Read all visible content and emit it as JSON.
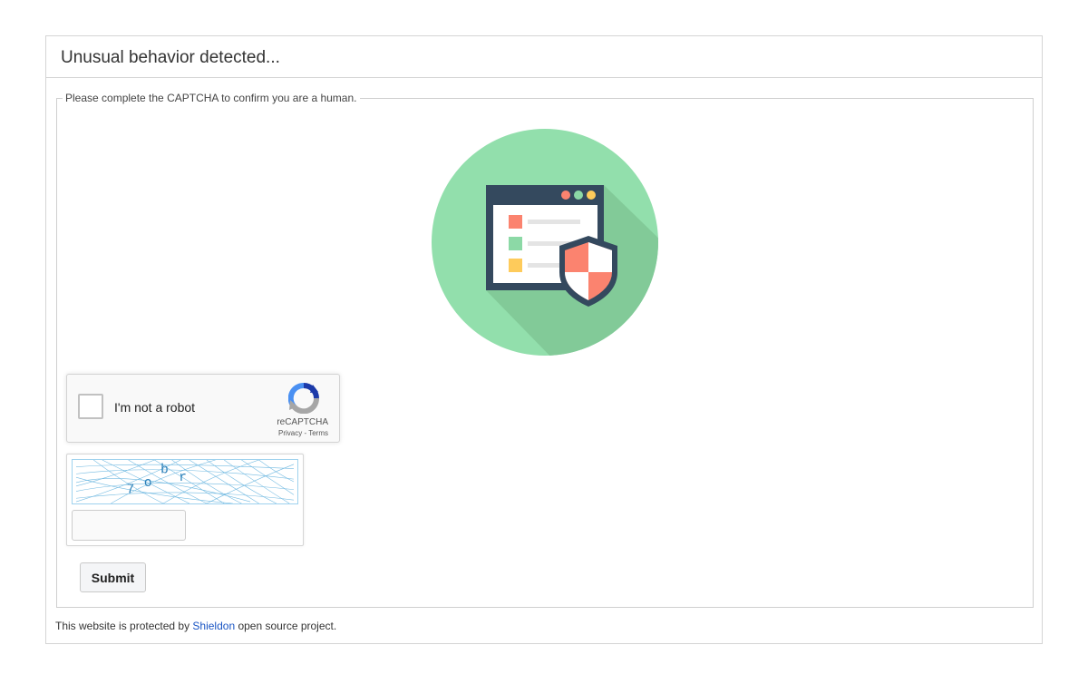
{
  "header": {
    "title": "Unusual behavior detected..."
  },
  "form": {
    "legend": "Please complete the CAPTCHA to confirm you are a human."
  },
  "illustration": {
    "icon": "browser-shield-illustration",
    "colors": {
      "circle": "#92dfac",
      "shadow": "#82ca98",
      "window": "#34495e",
      "red": "#fb836f",
      "green": "#8cd9a6",
      "yellow": "#fecb5b"
    }
  },
  "recaptcha": {
    "label": "I'm not a robot",
    "brand": "reCAPTCHA",
    "privacy": "Privacy",
    "separator": " - ",
    "terms": "Terms"
  },
  "image_captcha": {
    "characters": [
      "7",
      "o",
      "b",
      "r"
    ],
    "input_value": ""
  },
  "submit": {
    "label": "Submit"
  },
  "footer": {
    "prefix": "This website is protected by ",
    "link": "Shieldon",
    "suffix": " open source project."
  }
}
